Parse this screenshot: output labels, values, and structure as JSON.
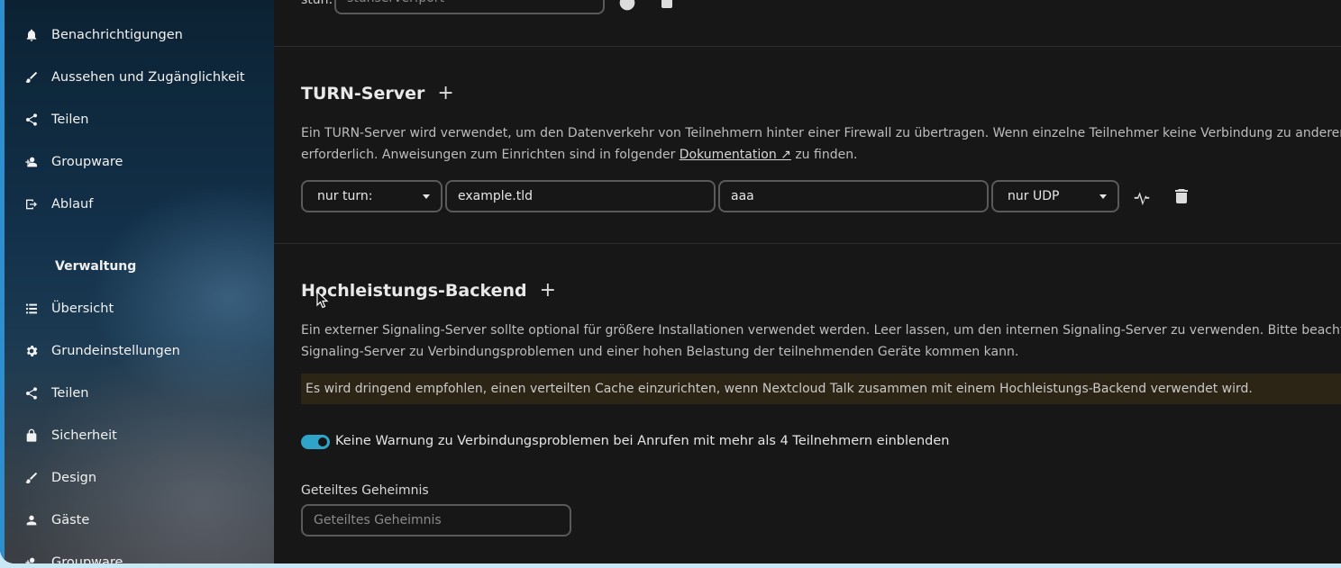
{
  "sidebar": {
    "personal_items": [
      {
        "label": "Benachrichtigungen",
        "icon": "bell-icon"
      },
      {
        "label": "Aussehen und Zugänglichkeit",
        "icon": "paintbrush-icon"
      },
      {
        "label": "Teilen",
        "icon": "share-icon"
      },
      {
        "label": "Groupware",
        "icon": "groupware-icon"
      },
      {
        "label": "Ablauf",
        "icon": "flow-icon"
      }
    ],
    "admin_caption": "Verwaltung",
    "admin_items": [
      {
        "label": "Übersicht",
        "icon": "list-icon"
      },
      {
        "label": "Grundeinstellungen",
        "icon": "gear-icon"
      },
      {
        "label": "Teilen",
        "icon": "share-icon"
      },
      {
        "label": "Sicherheit",
        "icon": "lock-icon"
      },
      {
        "label": "Design",
        "icon": "paintbrush-icon"
      },
      {
        "label": "Gäste",
        "icon": "user-icon"
      },
      {
        "label": "Groupware",
        "icon": "groupware-icon"
      }
    ]
  },
  "stun": {
    "label": "stun:",
    "placeholder": "stunserver:port"
  },
  "turn": {
    "title": "TURN-Server",
    "add_label": "+",
    "desc_line1": "Ein TURN-Server wird verwendet, um den Datenverkehr von Teilnehmern hinter einer Firewall zu übertragen. Wenn einzelne Teilnehmer keine Verbindung zu anderen hers",
    "desc_line2_pre": "erforderlich. Anweisungen zum Einrichten sind in folgender ",
    "doc_link": "Dokumentation ↗",
    "desc_line2_post": " zu finden.",
    "scheme": "nur turn:",
    "server": "example.tld",
    "secret": "aaa",
    "protocol": "nur UDP"
  },
  "hpb": {
    "title": "Hochleistungs-Backend",
    "add_label": "+",
    "desc_line1": "Ein externer Signaling-Server sollte optional für größere Installationen verwendet werden. Leer lassen, um den internen Signaling-Server zu verwenden. Bitte beachten Sie",
    "desc_line2": "Signaling-Server zu Verbindungsproblemen und einer hohen Belastung der teilnehmenden Geräte kommen kann.",
    "warning": "Es wird dringend empfohlen, einen verteilten Cache einzurichten, wenn Nextcloud Talk zusammen mit einem Hochleistungs-Backend verwendet wird.",
    "toggle_label": "Keine Warnung zu Verbindungsproblemen bei Anrufen mit mehr als 4 Teilnehmern einblenden",
    "toggle_on": true,
    "secret_label": "Geteiltes Geheimnis",
    "secret_placeholder": "Geteiltes Geheimnis"
  },
  "colors": {
    "accent": "#2fa3c8",
    "sidebar_border": "#2d8fcf",
    "warning_bg": "#2c2516",
    "background": "#171717"
  }
}
